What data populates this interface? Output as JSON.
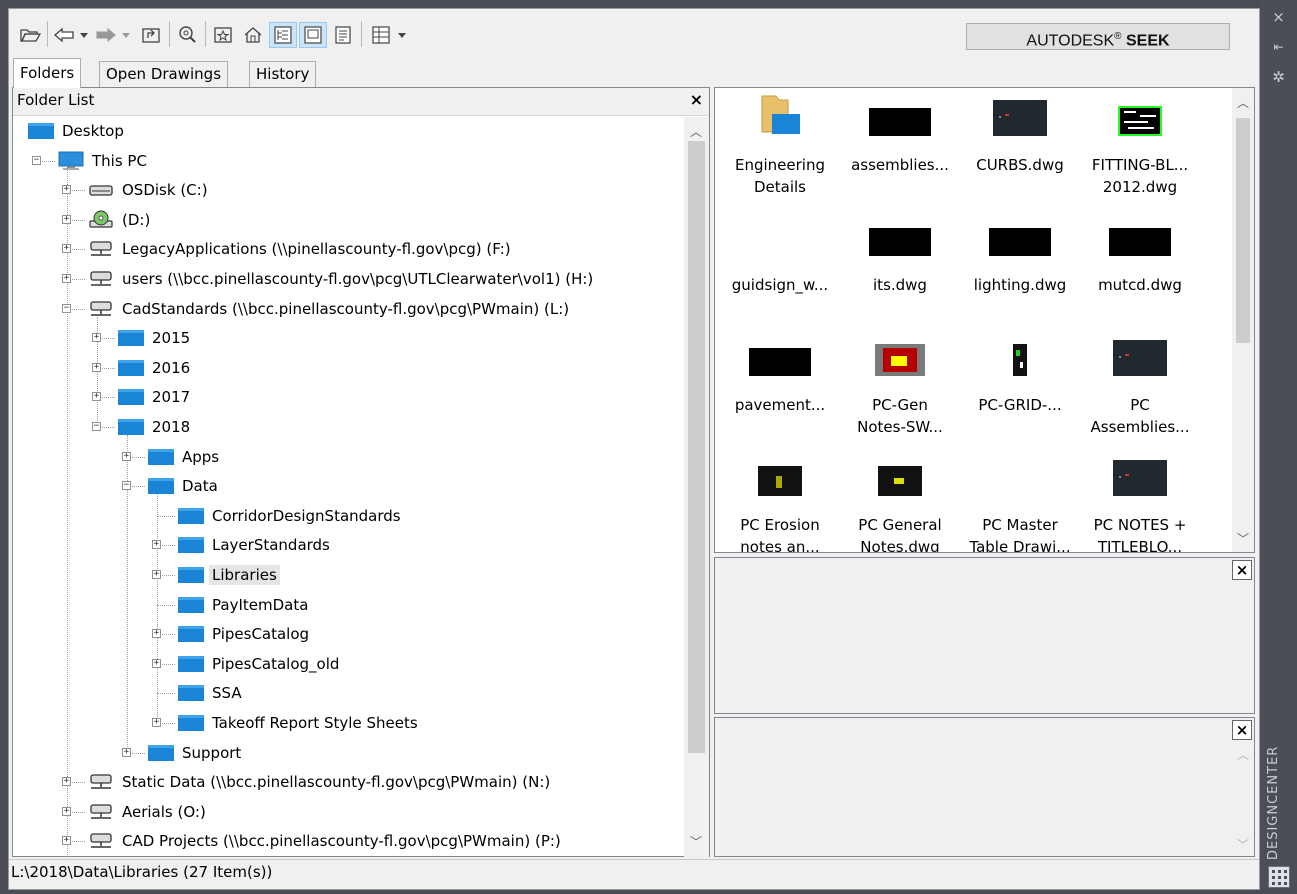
{
  "toolbar": {
    "seek_brand": "AUTODESK",
    "seek_reg": "®",
    "seek_word": "SEEK"
  },
  "tabs": [
    {
      "label": "Folders",
      "active": true
    },
    {
      "label": "Open Drawings",
      "active": false
    },
    {
      "label": "History",
      "active": false
    }
  ],
  "folder_list": {
    "title": "Folder List",
    "close": "×",
    "nodes": [
      {
        "label": "Desktop",
        "icon": "desktop-folder-icon",
        "expander": "none"
      },
      {
        "label": "This PC",
        "icon": "computer-icon",
        "expander": "minus"
      },
      {
        "label": "OSDisk (C:)",
        "icon": "hard-drive-icon",
        "expander": "plus"
      },
      {
        "label": "(D:)",
        "icon": "cd-drive-icon",
        "expander": "plus"
      },
      {
        "label": "LegacyApplications (\\\\pinellascounty-fl.gov\\pcg) (F:)",
        "icon": "network-drive-icon",
        "expander": "plus"
      },
      {
        "label": "users (\\\\bcc.pinellascounty-fl.gov\\pcg\\UTLClearwater\\vol1) (H:)",
        "icon": "network-drive-icon",
        "expander": "plus"
      },
      {
        "label": "CadStandards (\\\\bcc.pinellascounty-fl.gov\\pcg\\PWmain) (L:)",
        "icon": "network-drive-icon",
        "expander": "minus"
      },
      {
        "label": "2015",
        "icon": "folder-icon",
        "expander": "plus"
      },
      {
        "label": "2016",
        "icon": "folder-icon",
        "expander": "plus"
      },
      {
        "label": "2017",
        "icon": "folder-icon",
        "expander": "plus"
      },
      {
        "label": "2018",
        "icon": "folder-icon",
        "expander": "minus"
      },
      {
        "label": "Apps",
        "icon": "folder-icon",
        "expander": "plus"
      },
      {
        "label": "Data",
        "icon": "folder-icon",
        "expander": "minus"
      },
      {
        "label": "CorridorDesignStandards",
        "icon": "folder-icon",
        "expander": "none"
      },
      {
        "label": "LayerStandards",
        "icon": "folder-icon",
        "expander": "plus"
      },
      {
        "label": "Libraries",
        "icon": "folder-icon",
        "expander": "plus",
        "selected": true
      },
      {
        "label": "PayItemData",
        "icon": "folder-icon",
        "expander": "none"
      },
      {
        "label": "PipesCatalog",
        "icon": "folder-icon",
        "expander": "plus"
      },
      {
        "label": "PipesCatalog_old",
        "icon": "folder-icon",
        "expander": "plus"
      },
      {
        "label": "SSA",
        "icon": "folder-icon",
        "expander": "none"
      },
      {
        "label": "Takeoff Report Style Sheets",
        "icon": "folder-icon",
        "expander": "plus"
      },
      {
        "label": "Support",
        "icon": "folder-icon",
        "expander": "plus"
      },
      {
        "label": "Static Data (\\\\bcc.pinellascounty-fl.gov\\pcg\\PWmain) (N:)",
        "icon": "network-drive-icon",
        "expander": "plus"
      },
      {
        "label": "Aerials (O:)",
        "icon": "network-drive-icon",
        "expander": "plus"
      },
      {
        "label": "CAD Projects (\\\\bcc.pinellascounty-fl.gov\\pcg\\PWmain) (P:)",
        "icon": "network-drive-icon",
        "expander": "plus"
      }
    ]
  },
  "content": {
    "items": [
      {
        "line1": "Engineering",
        "line2": "Details",
        "thumb": "folder"
      },
      {
        "line1": "assemblies...",
        "line2": "",
        "thumb": "black"
      },
      {
        "line1": "CURBS.dwg",
        "line2": "",
        "thumb": "dark"
      },
      {
        "line1": "FITTING-BL...",
        "line2": "2012.dwg",
        "thumb": "green"
      },
      {
        "line1": "guidsign_w...",
        "line2": "",
        "thumb": "none"
      },
      {
        "line1": "its.dwg",
        "line2": "",
        "thumb": "black"
      },
      {
        "line1": "lighting.dwg",
        "line2": "",
        "thumb": "black"
      },
      {
        "line1": "mutcd.dwg",
        "line2": "",
        "thumb": "black"
      },
      {
        "line1": "pavement...",
        "line2": "",
        "thumb": "black"
      },
      {
        "line1": "PC-Gen",
        "line2": "Notes-SW...",
        "thumb": "red"
      },
      {
        "line1": "PC-GRID-...",
        "line2": "",
        "thumb": "narrow"
      },
      {
        "line1": "PC",
        "line2": "Assemblies...",
        "thumb": "dark"
      },
      {
        "line1": "PC Erosion",
        "line2": "notes an...",
        "thumb": "dark-small"
      },
      {
        "line1": "PC General",
        "line2": "Notes.dwg",
        "thumb": "dark-small2"
      },
      {
        "line1": "PC Master",
        "line2": "Table Drawi...",
        "thumb": "none"
      },
      {
        "line1": "PC NOTES +",
        "line2": "TITLEBLO...",
        "thumb": "dark"
      }
    ]
  },
  "panes": {
    "close_glyph": "×"
  },
  "status": {
    "text": "L:\\2018\\Data\\Libraries (27 Item(s))"
  },
  "palette": {
    "title": "DESIGNCENTER",
    "close_glyph": "×"
  }
}
